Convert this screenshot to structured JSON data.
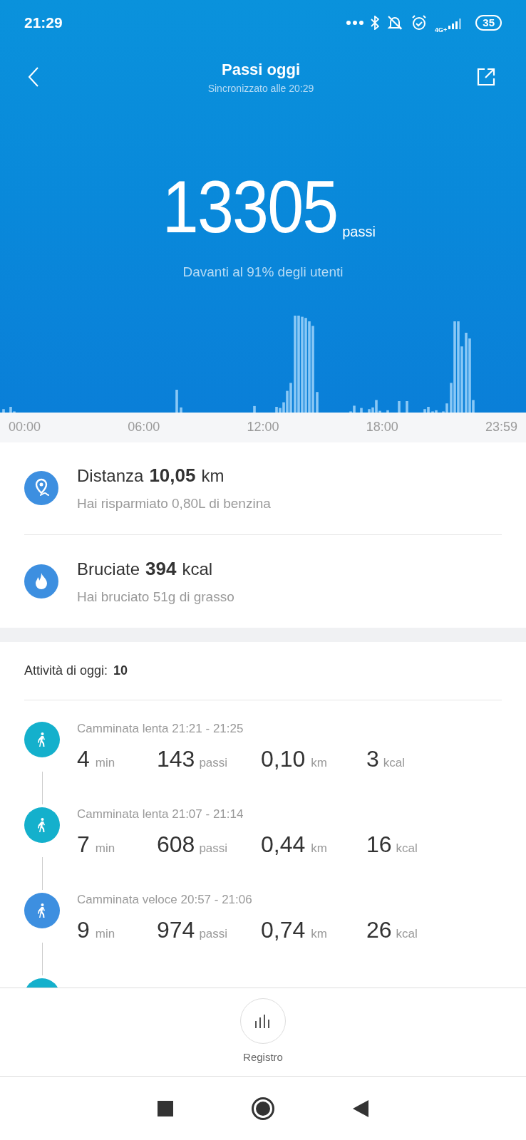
{
  "status_bar": {
    "time": "21:29",
    "network": "4G+",
    "battery": "35"
  },
  "header": {
    "title": "Passi oggi",
    "subtitle": "Sincronizzato alle 20:29"
  },
  "summary": {
    "steps": "13305",
    "unit": "passi",
    "rank": "Davanti al 91% degli utenti"
  },
  "time_axis": [
    "00:00",
    "06:00",
    "12:00",
    "18:00",
    "23:59"
  ],
  "stats": [
    {
      "kind": "distance",
      "label": "Distanza",
      "value": "10,05",
      "unit": "km",
      "note": "Hai risparmiato 0,80L di benzina"
    },
    {
      "kind": "calories",
      "label": "Bruciate",
      "value": "394",
      "unit": "kcal",
      "note": "Hai bruciato 51g di grasso"
    }
  ],
  "activities_header": {
    "label": "Attività di oggi:",
    "count": "10"
  },
  "activities": [
    {
      "title": "Camminata lenta 21:21 - 21:25",
      "color": "#14b0cc",
      "minutes": "4",
      "min_unit": "min",
      "steps": "143",
      "steps_unit": "passi",
      "km": "0,10",
      "km_unit": "km",
      "kcal": "3",
      "kcal_unit": "kcal"
    },
    {
      "title": "Camminata lenta 21:07 - 21:14",
      "color": "#14b0cc",
      "minutes": "7",
      "min_unit": "min",
      "steps": "608",
      "steps_unit": "passi",
      "km": "0,44",
      "km_unit": "km",
      "kcal": "16",
      "kcal_unit": "kcal"
    },
    {
      "title": "Camminata veloce 20:57 - 21:06",
      "color": "#3d8fe0",
      "minutes": "9",
      "min_unit": "min",
      "steps": "974",
      "steps_unit": "passi",
      "km": "0,74",
      "km_unit": "km",
      "kcal": "26",
      "kcal_unit": "kcal"
    },
    {
      "color": "#14b0cc"
    }
  ],
  "bottom_tab": {
    "label": "Registro"
  }
}
